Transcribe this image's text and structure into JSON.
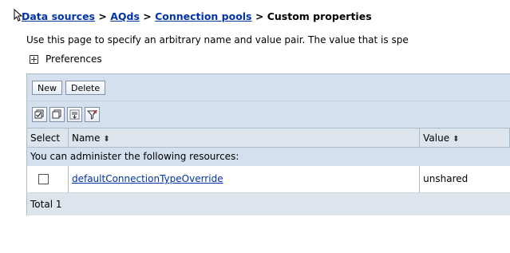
{
  "breadcrumb": {
    "items": [
      "Data sources",
      "AQds",
      "Connection pools"
    ],
    "separator": ">",
    "current": "Custom properties"
  },
  "description": "Use this page to specify an arbitrary name and value pair. The value that is spe",
  "preferences_label": "Preferences",
  "toolbar": {
    "new_label": "New",
    "delete_label": "Delete",
    "icons": [
      "select-all-icon",
      "deselect-all-icon",
      "show-filter-icon",
      "clear-filter-icon"
    ]
  },
  "table": {
    "columns": [
      "Select",
      "Name",
      "Value"
    ],
    "info": "You can administer the following resources:",
    "rows": [
      {
        "name": "defaultConnectionTypeOverride",
        "value": "unshared"
      }
    ],
    "total": "Total 1"
  }
}
